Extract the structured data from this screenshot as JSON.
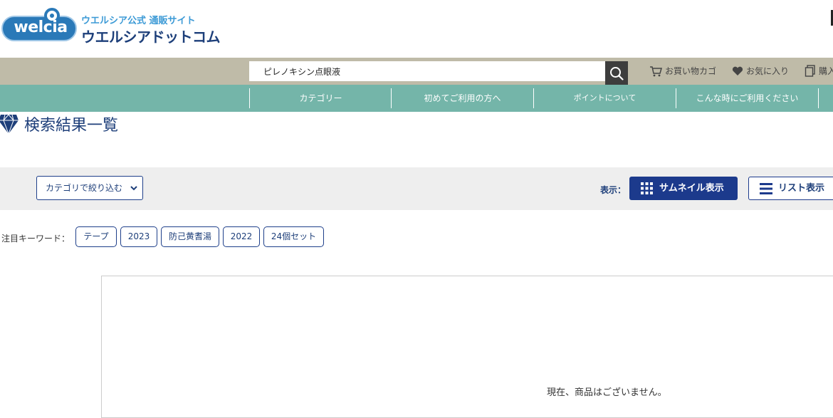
{
  "header": {
    "logo_text": "welcia",
    "logo_subtitle": "ウエルシア公式 通販サイト",
    "logo_title": "ウエルシアドットコム"
  },
  "search": {
    "value": "ピレノキシン点眼液"
  },
  "header_links": {
    "cart": "お買い物カゴ",
    "favorites": "お気に入り",
    "purchase": "購入"
  },
  "nav": {
    "items": [
      "カテゴリー",
      "初めてご利用の方へ",
      "ポイントについて",
      "こんな時にご利用ください"
    ]
  },
  "page": {
    "title": "検索結果一覧"
  },
  "filter": {
    "category_select": "カテゴリで絞り込む",
    "display_label": "表示：",
    "thumbnail_button": "サムネイル表示",
    "list_button": "リスト表示"
  },
  "keywords": {
    "label": "注目キーワード：",
    "items": [
      "テープ",
      "2023",
      "防己黄耆湯",
      "2022",
      "24個セット"
    ]
  },
  "results": {
    "empty_message": "現在、商品はございません。"
  },
  "colors": {
    "search_band": "#bfbba8",
    "nav_band": "#74b5a9",
    "primary_navy": "#1c3a8c",
    "filter_band": "#eeeeee"
  }
}
